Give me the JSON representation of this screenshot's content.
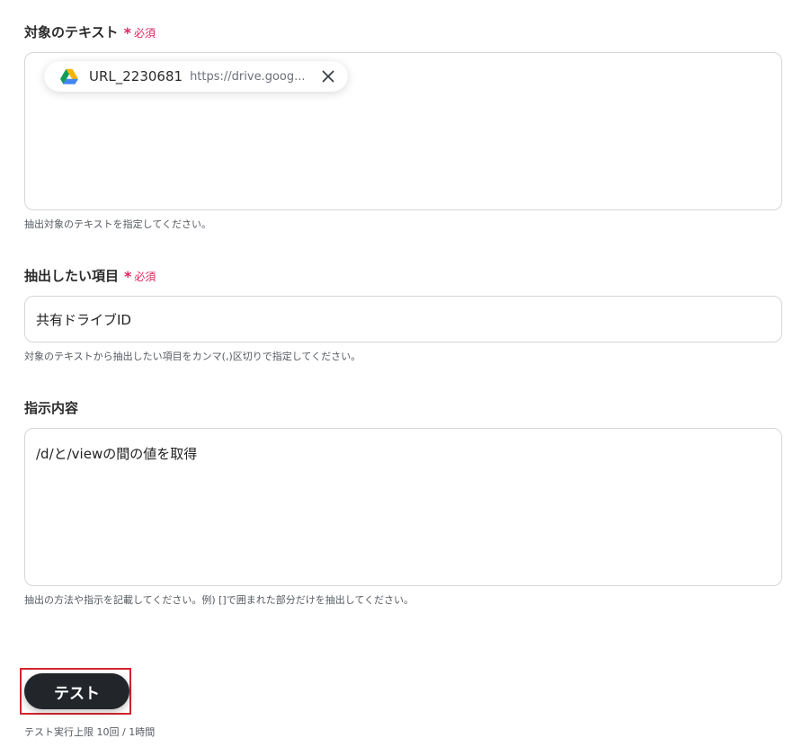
{
  "target_text": {
    "label": "対象のテキスト",
    "required_label": "必須",
    "chip": {
      "icon": "google-drive-icon",
      "name": "URL_2230681",
      "url": "https://drive.goog..."
    },
    "help": "抽出対象のテキストを指定してください。"
  },
  "extract_items": {
    "label": "抽出したい項目",
    "required_label": "必須",
    "value": "共有ドライブID",
    "help": "対象のテキストから抽出したい項目をカンマ(,)区切りで指定してください。"
  },
  "instructions": {
    "label": "指示内容",
    "value": "/d/と/viewの間の値を取得",
    "help": "抽出の方法や指示を記載してください。例) []で囲まれた部分だけを抽出してください。"
  },
  "test": {
    "button_label": "テスト",
    "limit_text": "テスト実行上限 10回 / 1時間"
  },
  "colors": {
    "required": "#e0245e",
    "button_bg": "#22262b",
    "highlight": "#d3262c"
  }
}
